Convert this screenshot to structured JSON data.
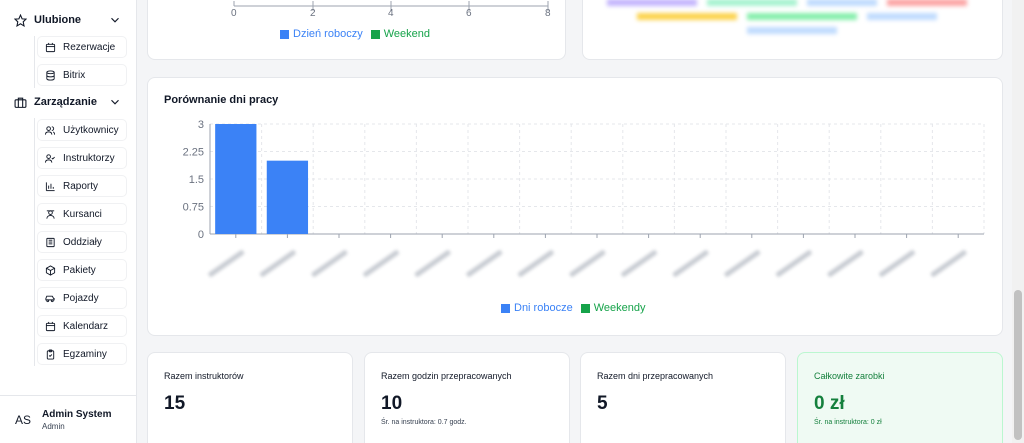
{
  "sidebar": {
    "groups": [
      {
        "label": "Ulubione",
        "icon": "star-icon",
        "items": [
          {
            "label": "Rezerwacje",
            "icon": "calendar-icon"
          },
          {
            "label": "Bitrix",
            "icon": "database-icon"
          }
        ]
      },
      {
        "label": "Zarządzanie",
        "icon": "briefcase-icon",
        "items": [
          {
            "label": "Użytkownicy",
            "icon": "users-icon"
          },
          {
            "label": "Instruktorzy",
            "icon": "user-check-icon"
          },
          {
            "label": "Raporty",
            "icon": "bar-chart-icon"
          },
          {
            "label": "Kursanci",
            "icon": "graduation-icon"
          },
          {
            "label": "Oddziały",
            "icon": "building-icon"
          },
          {
            "label": "Pakiety",
            "icon": "package-icon"
          },
          {
            "label": "Pojazdy",
            "icon": "car-icon"
          },
          {
            "label": "Kalendarz",
            "icon": "calendar-icon"
          },
          {
            "label": "Egzaminy",
            "icon": "clipboard-check-icon"
          }
        ]
      }
    ],
    "user": {
      "initials": "AS",
      "name": "Admin System",
      "role": "Admin"
    }
  },
  "top_chart": {
    "x_ticks": [
      "0",
      "2",
      "4",
      "6",
      "8"
    ],
    "legend": [
      {
        "label": "Dzień roboczy",
        "color": "#3b82f6"
      },
      {
        "label": "Weekend",
        "color": "#16a34a"
      }
    ]
  },
  "chart_data": {
    "type": "bar",
    "title": "Porównanie dni pracy",
    "ylim": [
      0,
      3
    ],
    "y_ticks": [
      "3",
      "2.25",
      "1.5",
      "0.75",
      "0"
    ],
    "grid": true,
    "legend_position": "bottom",
    "categories_count": 15,
    "series": [
      {
        "name": "Dni robocze",
        "color": "#3b82f6",
        "values": [
          3,
          2,
          0,
          0,
          0,
          0,
          0,
          0,
          0,
          0,
          0,
          0,
          0,
          0,
          0
        ]
      },
      {
        "name": "Weekendy",
        "color": "#16a34a",
        "values": [
          0,
          0,
          0,
          0,
          0,
          0,
          0,
          0,
          0,
          0,
          0,
          0,
          0,
          0,
          0
        ]
      }
    ]
  },
  "stats": [
    {
      "label": "Razem instruktorów",
      "value": "15",
      "sub": ""
    },
    {
      "label": "Razem godzin przepracowanych",
      "value": "10",
      "sub": "Śr. na instruktora: 0.7 godz."
    },
    {
      "label": "Razem dni przepracowanych",
      "value": "5",
      "sub": ""
    },
    {
      "label": "Całkowite zarobki",
      "value": "0 zł",
      "sub": "Śr. na instruktora: 0 zł"
    }
  ],
  "colors": {
    "primary": "#3b82f6",
    "success": "#16a34a"
  }
}
